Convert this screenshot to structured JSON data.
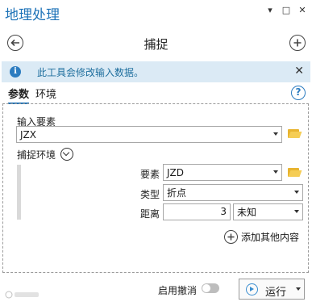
{
  "pane": {
    "title": "地理处理",
    "controls": [
      "▾",
      "□",
      "✕"
    ]
  },
  "tool": {
    "title": "捕捉",
    "back_icon": "back-arrow-icon",
    "add_icon": "add-circle-icon"
  },
  "banner": {
    "message": "此工具会修改输入数据。",
    "info_glyph": "i",
    "close_glyph": "✕"
  },
  "tabs": [
    {
      "label": "参数",
      "active": true
    },
    {
      "label": "环境",
      "active": false
    }
  ],
  "help_glyph": "?",
  "params": {
    "input_label": "输入要素",
    "input_value": "JZX",
    "snap_env_label": "捕捉环境",
    "snap_rows": {
      "feature_label": "要素",
      "feature_value": "JZD",
      "type_label": "类型",
      "type_value": "折点",
      "distance_label": "距离",
      "distance_value": "3",
      "unit_value": "未知"
    },
    "add_more_label": "添加其他内容"
  },
  "footer": {
    "undo_label": "启用撤消",
    "undo_enabled": false,
    "run_label": "运行"
  },
  "colors": {
    "accent": "#1e73b8",
    "banner_bg": "#dbeaf5",
    "folder": "#e8b430"
  }
}
